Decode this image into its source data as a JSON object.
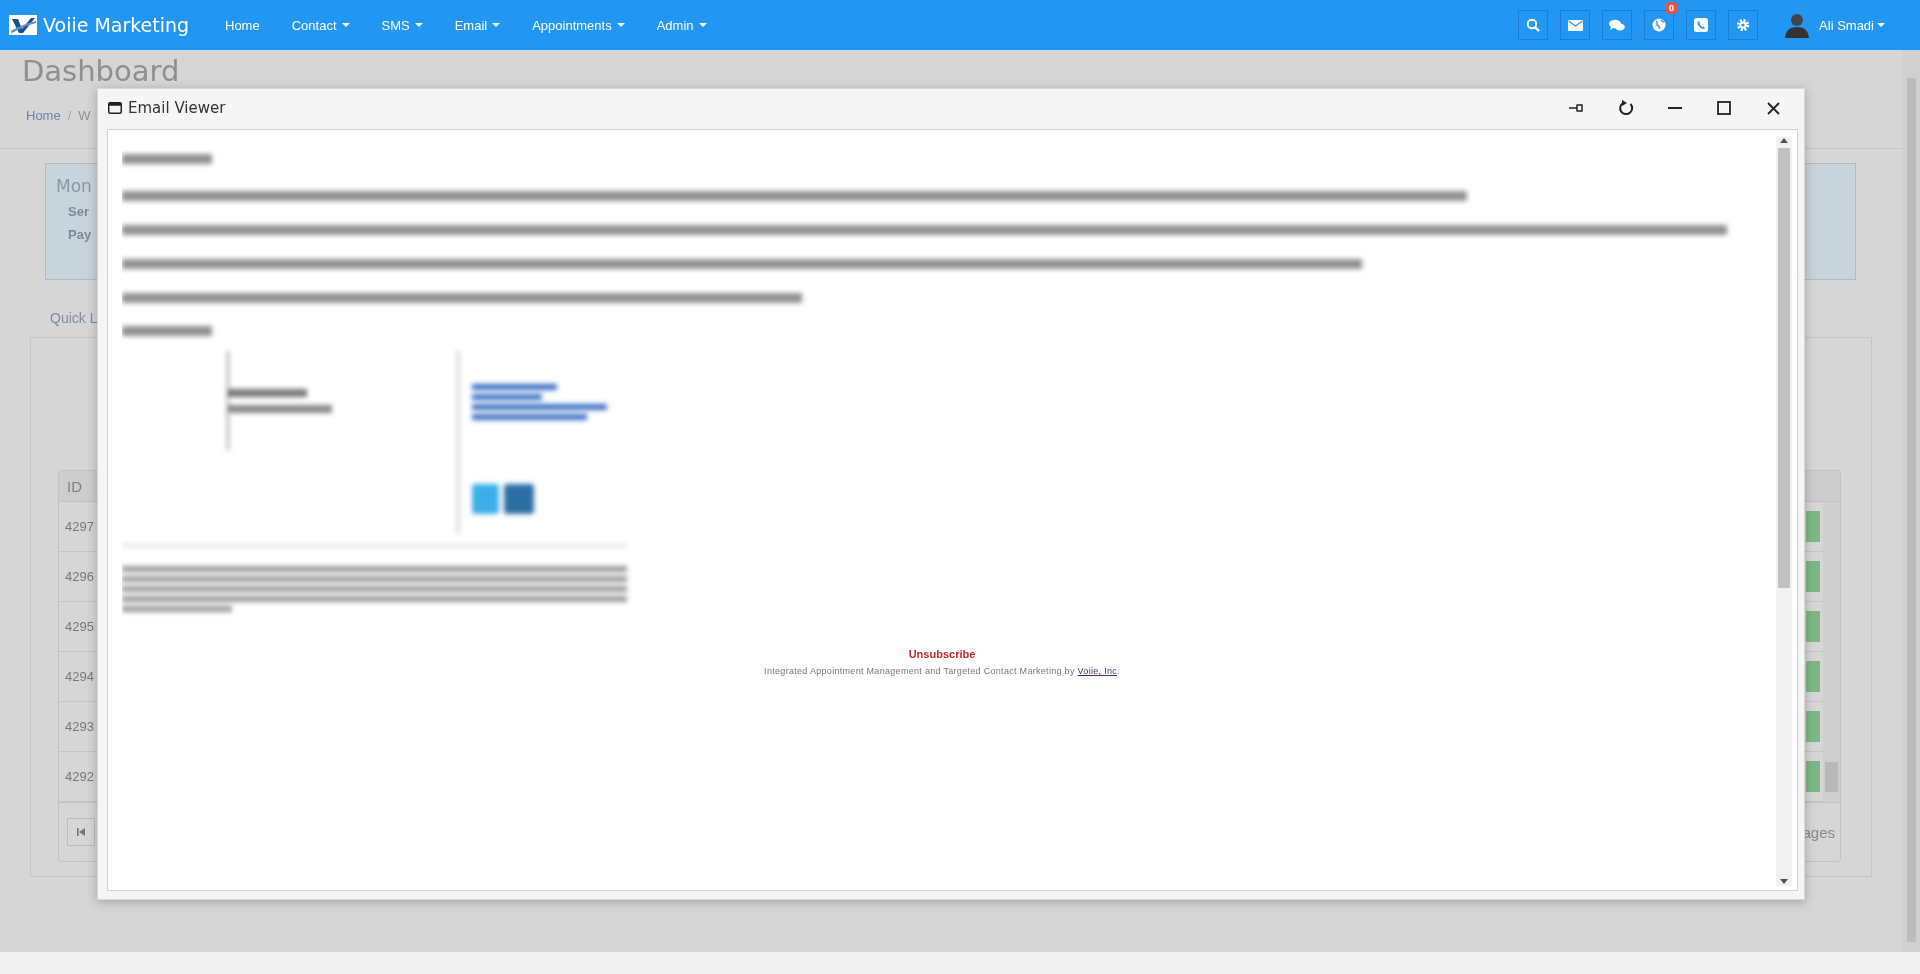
{
  "navbar": {
    "brand": "Voiie Marketing",
    "menu": [
      {
        "label": "Home",
        "dropdown": false
      },
      {
        "label": "Contact",
        "dropdown": true
      },
      {
        "label": "SMS",
        "dropdown": true
      },
      {
        "label": "Email",
        "dropdown": true
      },
      {
        "label": "Appointments",
        "dropdown": true
      },
      {
        "label": "Admin",
        "dropdown": true
      }
    ],
    "icon_buttons": [
      {
        "kind": "search"
      },
      {
        "kind": "mail"
      },
      {
        "kind": "chat"
      },
      {
        "kind": "globe",
        "badge": "0"
      },
      {
        "kind": "phone"
      },
      {
        "kind": "settings"
      }
    ],
    "user": {
      "name": "Ali Smadi"
    }
  },
  "page": {
    "title": "Dashboard",
    "breadcrumb": [
      {
        "kind": "link",
        "text": "Home"
      },
      {
        "kind": "separator",
        "text": "/"
      },
      {
        "kind": "current",
        "text": "W"
      }
    ],
    "alert": {
      "title": "Mon",
      "lines": [
        "Ser",
        "Pay"
      ]
    },
    "tab": "Quick L",
    "table": {
      "header": "ID",
      "rows": [
        "4297",
        "4296",
        "4295",
        "4294",
        "4293",
        "4292"
      ],
      "pager_text": "ages"
    }
  },
  "modal": {
    "title": "Email Viewer",
    "email": {
      "unsubscribe": "Unsubscribe",
      "footer": "Integrated Appointment Management and Targeted Contact Marketing by",
      "footer_link": "Voiie, Inc",
      "footer_end": "."
    }
  }
}
